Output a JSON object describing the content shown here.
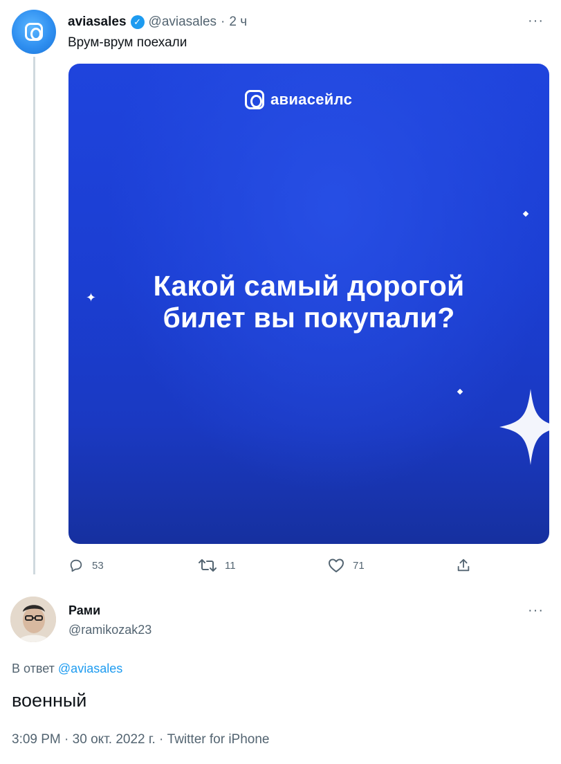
{
  "tweet": {
    "author_name": "aviasales",
    "author_handle": "@aviasales",
    "separator": "·",
    "time_ago": "2 ч",
    "text": "Врум-врум поехали",
    "media": {
      "brand_text": "авиасейлс",
      "headline_line1": "Какой самый дорогой",
      "headline_line2": "билет вы покупали?",
      "background_color": "#1d3fd6"
    },
    "stats": {
      "replies": "53",
      "retweets": "11",
      "likes": "71"
    }
  },
  "reply": {
    "author_name": "Рами",
    "author_handle": "@ramikozak23",
    "reply_prefix": "В ответ",
    "reply_mention": "@aviasales",
    "text": "военный",
    "timestamp": "3:09 PM",
    "date": "30 окт. 2022 г.",
    "source": "Twitter for iPhone",
    "separator": "·"
  },
  "more_menu_glyph": "···",
  "colors": {
    "accent": "#1d9bf0",
    "muted": "#536471",
    "text": "#0f1419"
  },
  "icons": [
    "verified-badge-icon",
    "more-icon",
    "reply-icon",
    "retweet-icon",
    "like-icon",
    "share-icon",
    "brand-logo-icon"
  ]
}
